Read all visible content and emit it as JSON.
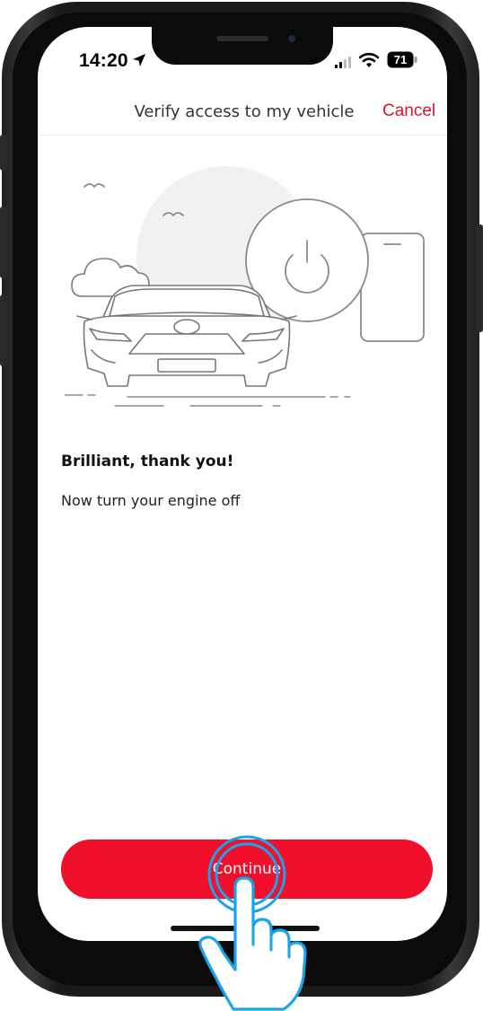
{
  "status_bar": {
    "time": "14:20",
    "battery": "71",
    "icons": [
      "location-arrow-icon",
      "signal-icon",
      "wifi-icon",
      "battery-icon"
    ]
  },
  "nav": {
    "title": "Verify access to my vehicle",
    "cancel_label": "Cancel"
  },
  "illustration": {
    "icons": [
      "car-icon",
      "cloud-icon",
      "bird-icon",
      "power-icon",
      "phone-icon"
    ]
  },
  "content": {
    "heading": "Brilliant, thank you!",
    "body": "Now turn your engine off"
  },
  "actions": {
    "continue_label": "Continue"
  },
  "colors": {
    "accent": "#f20f2c",
    "cancel_text": "#e0102a",
    "tap_indicator": "#1aa3e8"
  }
}
